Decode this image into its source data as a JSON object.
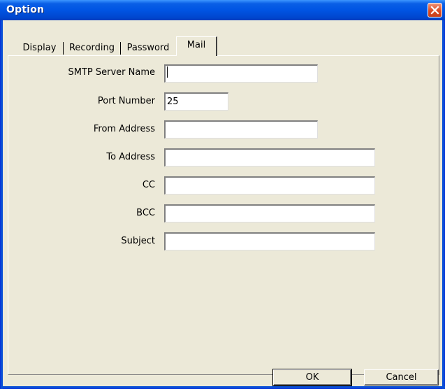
{
  "window": {
    "title": "Option"
  },
  "tabs": [
    {
      "label": "Display",
      "active": false
    },
    {
      "label": "Recording",
      "active": false
    },
    {
      "label": "Password",
      "active": false
    },
    {
      "label": "Mail",
      "active": true
    }
  ],
  "form": {
    "smtp_server": {
      "label": "SMTP Server Name",
      "value": ""
    },
    "port": {
      "label": "Port Number",
      "value": "25"
    },
    "from": {
      "label": "From Address",
      "value": ""
    },
    "to": {
      "label": "To Address",
      "value": ""
    },
    "cc": {
      "label": "CC",
      "value": ""
    },
    "bcc": {
      "label": "BCC",
      "value": ""
    },
    "subject": {
      "label": "Subject",
      "value": ""
    }
  },
  "buttons": {
    "ok": "OK",
    "cancel": "Cancel"
  },
  "colors": {
    "titlebar": "#0054e3",
    "dialog_bg": "#ece9d8",
    "close_button": "#dc4a22"
  },
  "icons": {
    "close": "close-icon"
  }
}
